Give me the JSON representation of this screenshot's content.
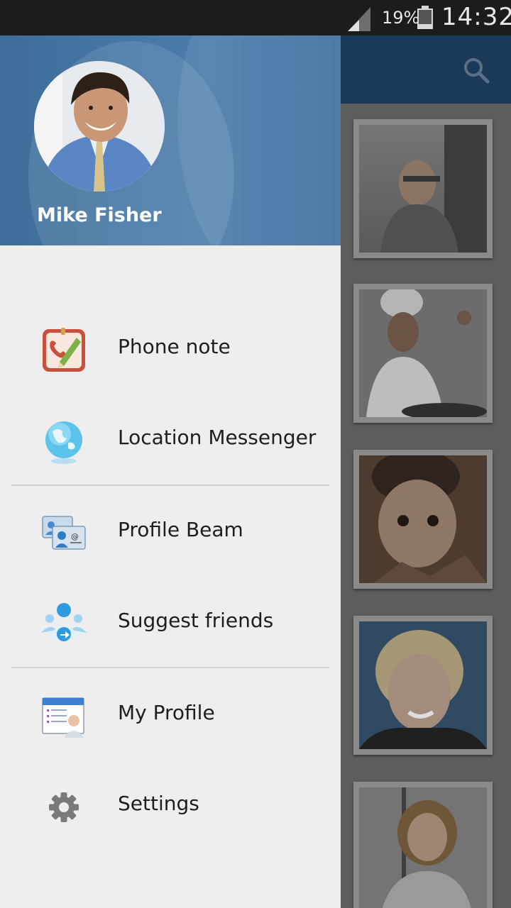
{
  "status_bar": {
    "battery": "19%",
    "time": "14:32"
  },
  "background_app": {
    "search_icon": "search-icon"
  },
  "drawer": {
    "user": {
      "name": "Mike Fisher"
    },
    "items": [
      {
        "label": "Phone note",
        "icon": "phone-note-icon"
      },
      {
        "label": "Location Messenger",
        "icon": "globe-icon"
      },
      {
        "label": "Profile Beam",
        "icon": "contact-cards-icon"
      },
      {
        "label": "Suggest friends",
        "icon": "suggest-friends-icon"
      },
      {
        "label": "My Profile",
        "icon": "profile-card-icon"
      },
      {
        "label": "Settings",
        "icon": "gear-icon"
      }
    ]
  }
}
